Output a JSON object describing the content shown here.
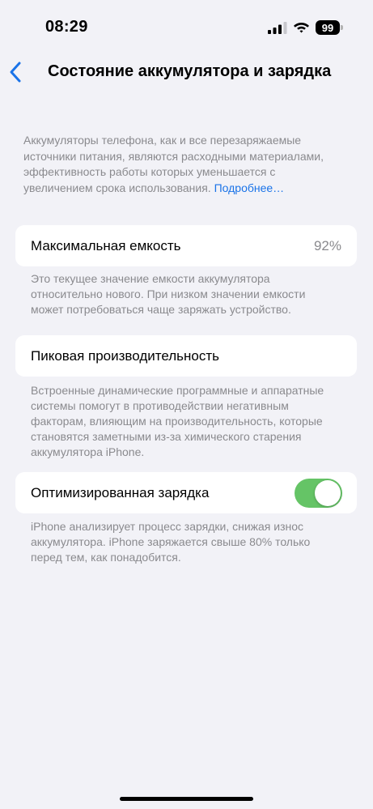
{
  "status_bar": {
    "time": "08:29",
    "battery_level": "99",
    "icons": [
      "signal-icon",
      "wifi-icon",
      "battery-icon"
    ]
  },
  "nav": {
    "back_icon": "chevron-left-icon",
    "title": "Состояние аккумулятора и зарядка",
    "accent_color": "#1a73e8"
  },
  "intro": {
    "text": "Аккумуляторы телефона, как и все перезаряжаемые источники питания, являются расходными материалами, эффективность работы которых уменьшается с увеличением срока использования.",
    "link": "Подробнее…"
  },
  "max_capacity": {
    "label": "Максимальная емкость",
    "value": "92%",
    "footnote": "Это текущее значение емкости аккумулятора относительно нового. При низком значении емкости может потребоваться чаще заряжать устройство."
  },
  "peak_performance": {
    "label": "Пиковая производительность",
    "footnote": "Встроенные динамические программные и аппаратные системы помогут в противодействии негативным факторам, влияющим на производительность, которые становятся заметными из-за химического старения аккумулятора iPhone."
  },
  "optimized_charging": {
    "label": "Оптимизированная зарядка",
    "enabled": true,
    "toggle_color": "#65c466",
    "footnote": "iPhone анализирует процесс зарядки, снижая износ аккумулятора. iPhone заряжается свыше 80% только перед тем, как понадобится."
  }
}
